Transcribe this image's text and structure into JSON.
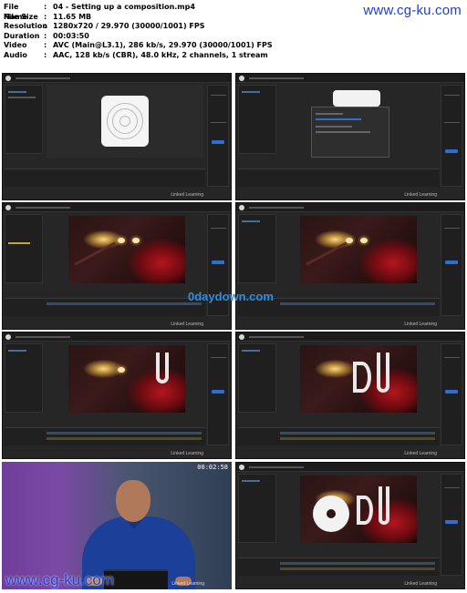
{
  "meta": {
    "rows": [
      {
        "key": "File Name",
        "sep": ":",
        "value": "04 - Setting up a composition.mp4"
      },
      {
        "key": "File Size",
        "sep": ":",
        "value": "11.65 MB"
      },
      {
        "key": "Resolution",
        "sep": ":",
        "value": "1280x720 / 29.970 (30000/1001) FPS"
      },
      {
        "key": "Duration",
        "sep": ":",
        "value": "00:03:50"
      },
      {
        "key": "Video",
        "sep": ":",
        "value": "AVC (Main@L3.1), 286 kb/s, 29.970 (30000/1001) FPS"
      },
      {
        "key": "Audio",
        "sep": ":",
        "value": "AAC, 128 kb/s (CBR), 48.0 kHz, 2 channels, 1 stream"
      }
    ]
  },
  "watermarks": {
    "top": "www.cg-ku.com",
    "middle": "0daydown.com",
    "bottom": "www.cg-ku.com"
  },
  "thumbnails": [
    {
      "brand": "Linked Learning",
      "content": "disc-logo"
    },
    {
      "brand": "Linked Learning",
      "content": "dialog"
    },
    {
      "brand": "Linked Learning",
      "content": "photo"
    },
    {
      "brand": "Linked Learning",
      "content": "photo"
    },
    {
      "brand": "Linked Learning",
      "content": "photo-dj"
    },
    {
      "brand": "Linked Learning",
      "content": "photo-dj"
    },
    {
      "brand": "Linked Learning",
      "content": "presenter",
      "timestamp": "00:02:58"
    },
    {
      "brand": "Linked Learning",
      "content": "photo-disc-dj"
    }
  ],
  "colors": {
    "watermark": "#1e3fcf",
    "daydown": "#2c8ee8",
    "ui_bg": "#262626",
    "accent_button": "#2d6fd0"
  }
}
